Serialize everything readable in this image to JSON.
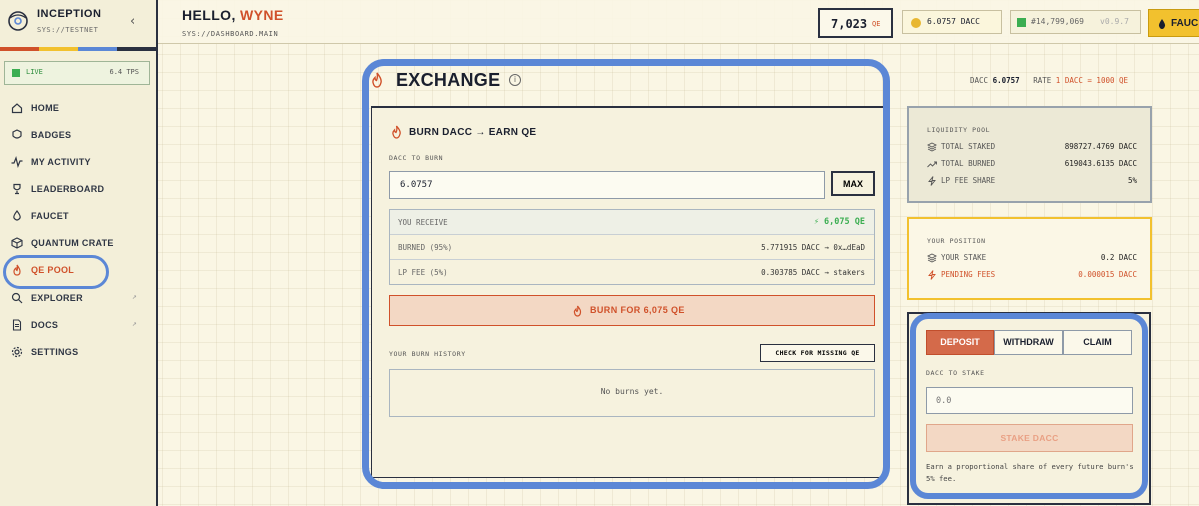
{
  "brand": {
    "name": "INCEPTION",
    "subtitle": "SYS://TESTNET",
    "collapse_glyph": "‹"
  },
  "colors": {
    "accent": "#d0512a",
    "yellow": "#f2c12e",
    "green": "#3cae52",
    "highlight": "#5b87d6"
  },
  "status": {
    "label": "LIVE",
    "tps": "6.4 TPS"
  },
  "nav": [
    {
      "label": "HOME",
      "icon": "home-icon"
    },
    {
      "label": "BADGES",
      "icon": "badge-icon"
    },
    {
      "label": "MY ACTIVITY",
      "icon": "activity-icon"
    },
    {
      "label": "LEADERBOARD",
      "icon": "trophy-icon"
    },
    {
      "label": "FAUCET",
      "icon": "faucet-icon"
    },
    {
      "label": "QUANTUM CRATE",
      "icon": "crate-icon"
    },
    {
      "label": "QE POOL",
      "icon": "flame-icon",
      "active": true
    },
    {
      "label": "EXPLORER",
      "icon": "search-icon",
      "external": "↗"
    },
    {
      "label": "DOCS",
      "icon": "docs-icon",
      "external": "↗"
    },
    {
      "label": "SETTINGS",
      "icon": "gear-icon"
    }
  ],
  "header": {
    "greeting": "HELLO,",
    "username": "WYNE",
    "path": "SYS://DASHBOARD.MAIN",
    "qe_balance": "7,023",
    "qe_unit": "QE",
    "dacc_balance": "6.0757 DACC",
    "block": "#14,799,069",
    "version": "v0.9.7",
    "faucet_label": "FAUC"
  },
  "exchange": {
    "title": "EXCHANGE",
    "info_glyph": "i",
    "balance_label": "DACC",
    "balance_value": "6.0757",
    "rate_label": "RATE",
    "rate_value": "1 DACC = 1000 QE",
    "burn": {
      "title": "BURN DACC → EARN QE",
      "input_label": "DACC TO BURN",
      "input_value": "6.0757",
      "max_label": "MAX",
      "rows": [
        {
          "label": "YOU RECEIVE",
          "value": "⚡ 6,075 QE"
        },
        {
          "label": "BURNED (95%)",
          "value": "5.771915 DACC → 0x…dEaD"
        },
        {
          "label": "LP FEE (5%)",
          "value": "0.303785 DACC → stakers"
        }
      ],
      "button_label": "BURN FOR 6,075 QE",
      "history_label": "YOUR BURN HISTORY",
      "check_label": "CHECK FOR MISSING QE",
      "empty_text": "No burns yet."
    }
  },
  "liquidity_pool": {
    "title": "LIQUIDITY POOL",
    "rows": [
      {
        "label": "TOTAL STAKED",
        "value": "898727.4769 DACC",
        "icon": "layers-icon"
      },
      {
        "label": "TOTAL BURNED",
        "value": "619043.6135 DACC",
        "icon": "trend-up-icon"
      },
      {
        "label": "LP FEE SHARE",
        "value": "5%",
        "icon": "bolt-icon"
      }
    ]
  },
  "position": {
    "title": "YOUR POSITION",
    "rows": [
      {
        "label": "YOUR STAKE",
        "value": "0.2 DACC",
        "icon": "layers-icon"
      },
      {
        "label": "PENDING FEES",
        "value": "0.000015 DACC",
        "icon": "bolt-icon"
      }
    ]
  },
  "stake": {
    "tabs": [
      "DEPOSIT",
      "WITHDRAW",
      "CLAIM"
    ],
    "active_tab": "DEPOSIT",
    "input_label": "DACC TO STAKE",
    "input_placeholder": "0.0",
    "button_label": "STAKE DACC",
    "note": "Earn a proportional share of every future burn's 5% fee."
  }
}
